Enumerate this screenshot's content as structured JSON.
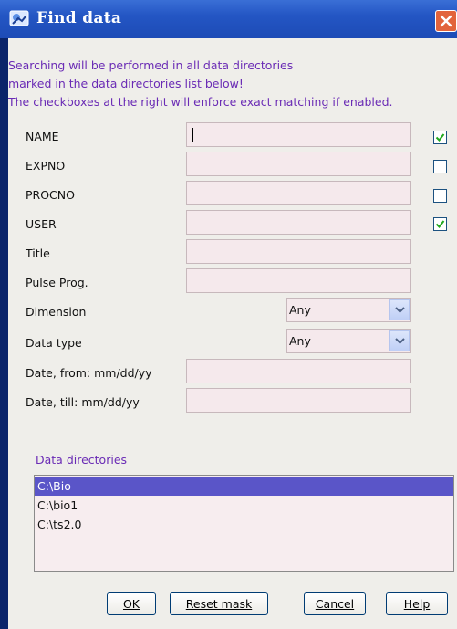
{
  "window": {
    "title": "Find data"
  },
  "info": {
    "line1": "Searching will be performed in all data directories",
    "line2": "marked in the data directories list below!",
    "line3": "The checkboxes at the right will enforce exact matching if enabled."
  },
  "fields": [
    {
      "label": "NAME",
      "value": "",
      "exact": true
    },
    {
      "label": "EXPNO",
      "value": "",
      "exact": false
    },
    {
      "label": "PROCNO",
      "value": "",
      "exact": false
    },
    {
      "label": "USER",
      "value": "",
      "exact": true
    },
    {
      "label": "Title",
      "value": ""
    },
    {
      "label": "Pulse Prog.",
      "value": ""
    }
  ],
  "selects": [
    {
      "label": "Dimension",
      "value": "Any"
    },
    {
      "label": "Data type",
      "value": "Any"
    }
  ],
  "dates": [
    {
      "label": "Date, from: mm/dd/yy",
      "value": ""
    },
    {
      "label": "Date, till: mm/dd/yy",
      "value": ""
    }
  ],
  "directories": {
    "label": "Data directories",
    "items": [
      "C:\\Bio",
      "C:\\bio1",
      "C:\\ts2.0"
    ],
    "selected_index": 0
  },
  "buttons": {
    "ok": "OK",
    "reset": "Reset mask",
    "cancel": "Cancel",
    "help": "Help"
  },
  "colors": {
    "titlebar": "#2456c4",
    "info_text": "#6a2bb5",
    "field_bg": "#f5e9ec",
    "selection": "#5a55c8",
    "checkmark": "#22a81e"
  }
}
